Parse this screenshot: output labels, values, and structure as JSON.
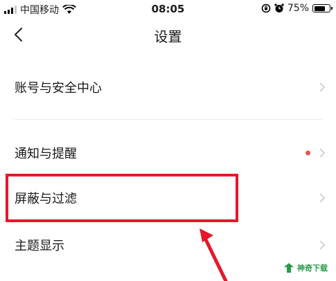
{
  "status_bar": {
    "carrier": "中国移动",
    "time": "08:05",
    "battery_percent": "75%",
    "battery_level": 0.75,
    "icons": [
      "signal-icon",
      "wifi-icon",
      "rotation-lock-icon",
      "alarm-icon",
      "battery-icon"
    ]
  },
  "nav": {
    "title": "设置",
    "back_icon": "chevron-left-icon"
  },
  "settings": {
    "items": [
      {
        "label": "账号与安全中心",
        "has_dot": false
      },
      {
        "label": "通知与提醒",
        "has_dot": true
      },
      {
        "label": "屏蔽与过滤",
        "has_dot": false
      },
      {
        "label": "主题显示",
        "has_dot": false
      }
    ]
  },
  "colors": {
    "highlight": "#e6172b",
    "notification_dot": "#e25555",
    "watermark": "#2a9a49"
  },
  "watermark": {
    "text": "神奇下载"
  }
}
